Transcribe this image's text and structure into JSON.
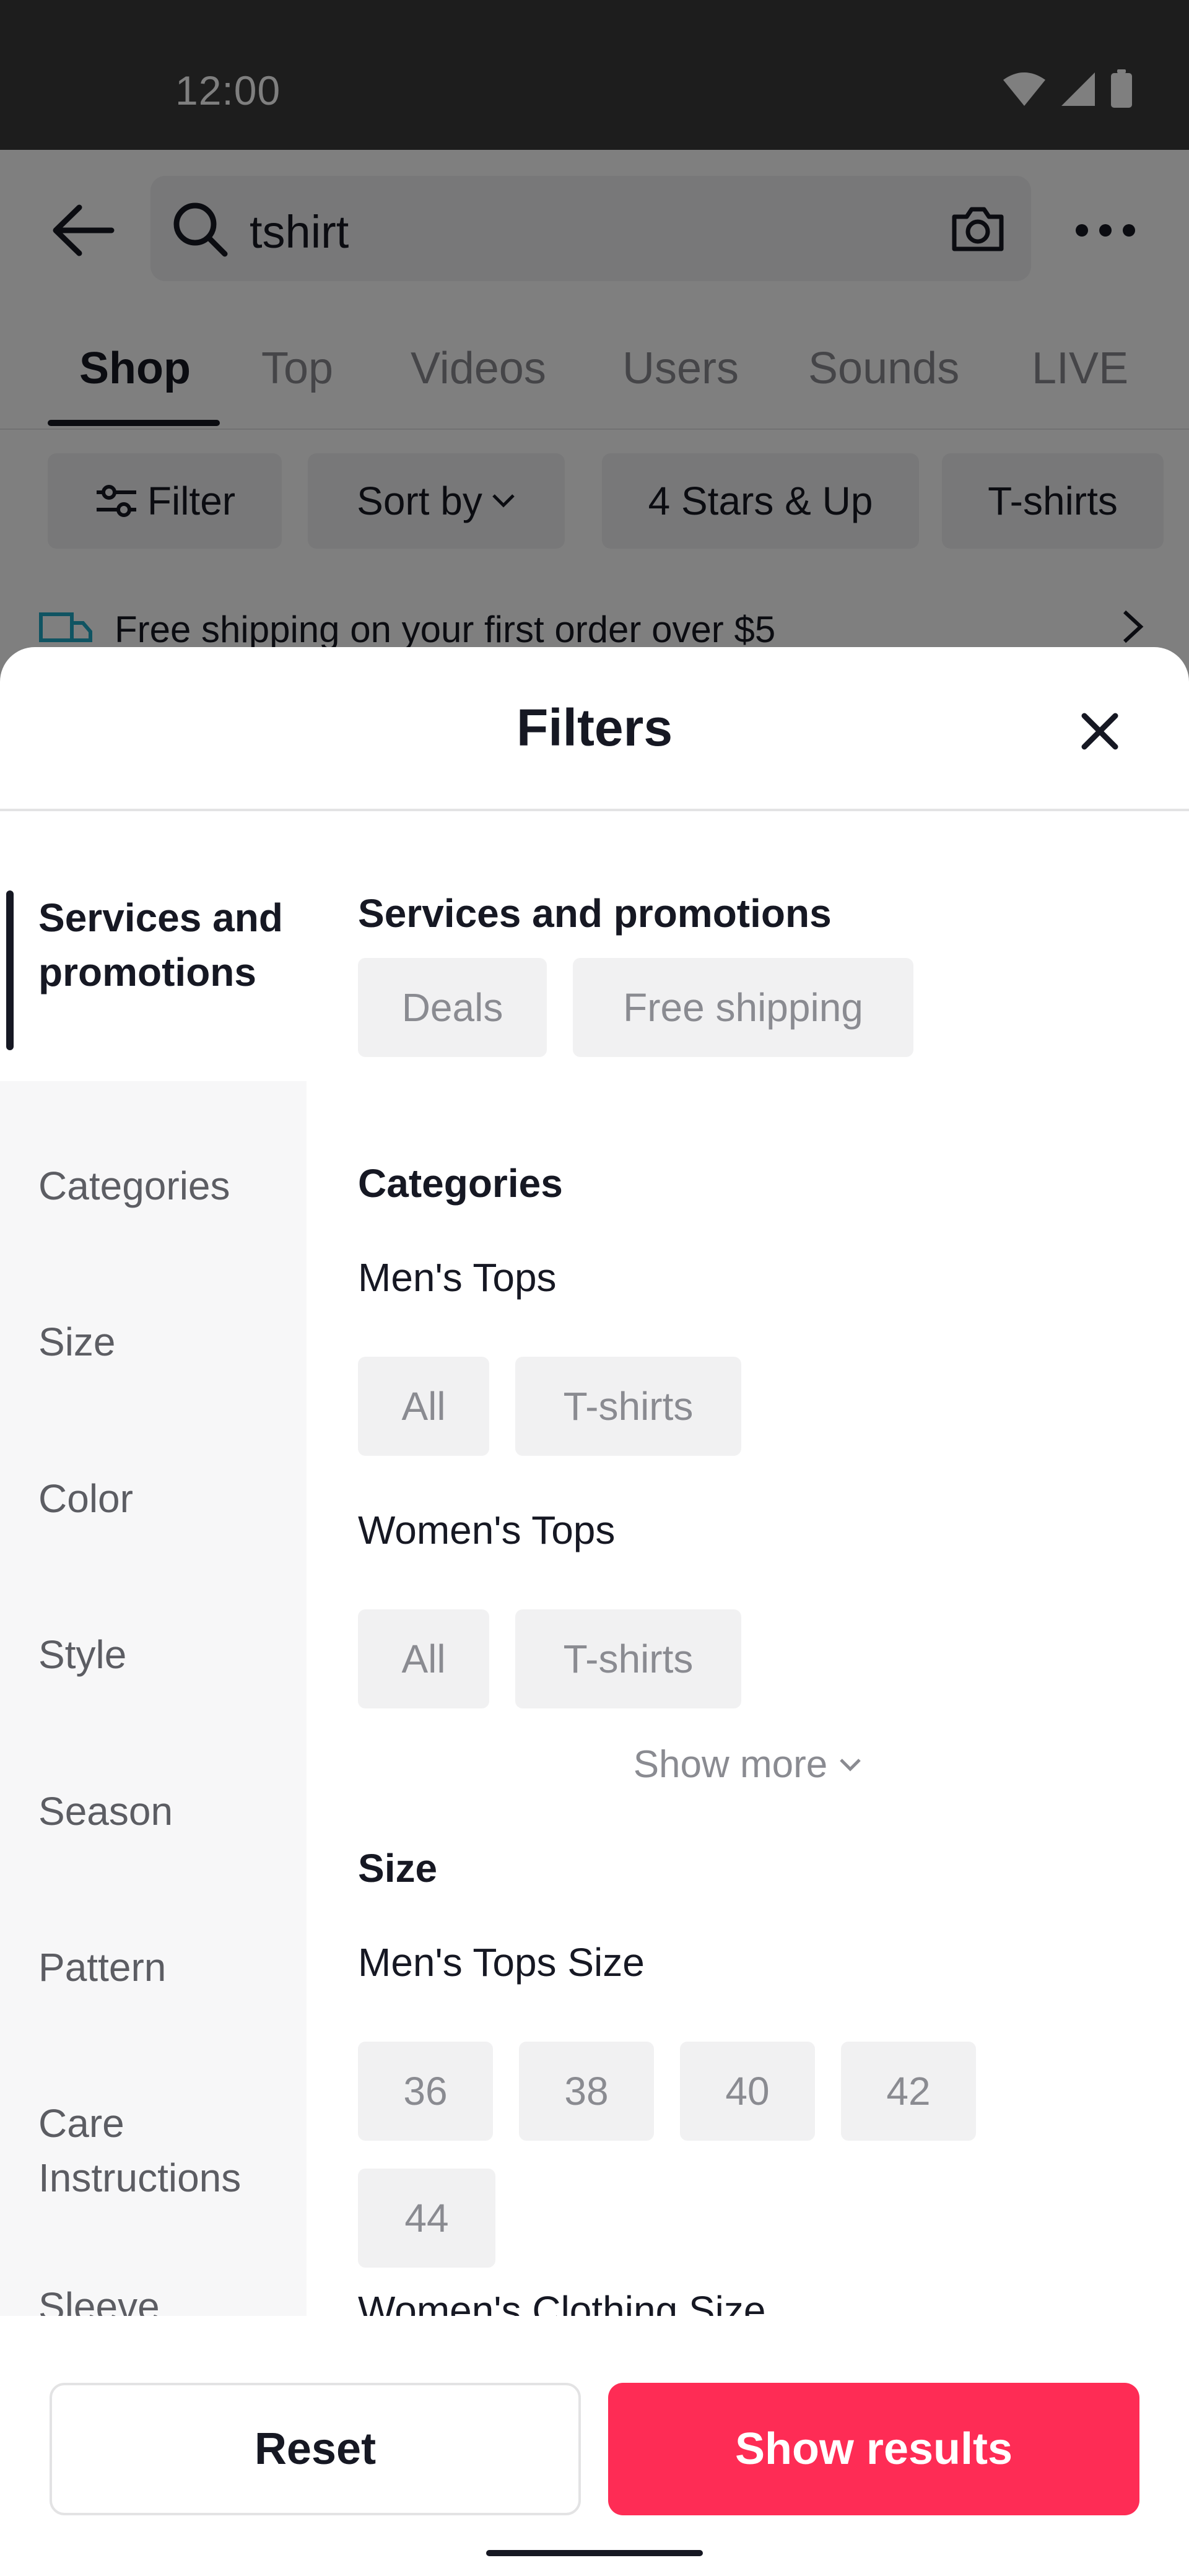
{
  "status_bar": {
    "time": "12:00"
  },
  "search": {
    "query": "tshirt"
  },
  "tabs": [
    {
      "label": "Shop"
    },
    {
      "label": "Top"
    },
    {
      "label": "Videos"
    },
    {
      "label": "Users"
    },
    {
      "label": "Sounds"
    },
    {
      "label": "LIVE"
    }
  ],
  "top_chips": [
    {
      "label": "Filter"
    },
    {
      "label": "Sort by"
    },
    {
      "label": "4 Stars & Up"
    },
    {
      "label": "T-shirts"
    }
  ],
  "promo": {
    "text": "Free shipping on your first order over $5"
  },
  "sheet": {
    "title": "Filters",
    "nav": [
      {
        "label": "Services and promotions"
      },
      {
        "label": "Categories"
      },
      {
        "label": "Size"
      },
      {
        "label": "Color"
      },
      {
        "label": "Style"
      },
      {
        "label": "Season"
      },
      {
        "label": "Pattern"
      },
      {
        "label": "Care Instructions"
      },
      {
        "label": "Sleeve"
      }
    ],
    "services": {
      "title": "Services and promotions",
      "chips": [
        "Deals",
        "Free shipping"
      ]
    },
    "categories": {
      "title": "Categories",
      "mens_title": "Men's Tops",
      "mens_chips": [
        "All",
        "T-shirts"
      ],
      "womens_title": "Women's Tops",
      "womens_chips": [
        "All",
        "T-shirts"
      ],
      "show_more": "Show more"
    },
    "size": {
      "title": "Size",
      "mens_title": "Men's Tops Size",
      "mens_chips": [
        "36",
        "38",
        "40",
        "42",
        "44"
      ],
      "womens_title": "Women's Clothing Size"
    },
    "footer": {
      "reset": "Reset",
      "show_results": "Show results"
    }
  },
  "colors": {
    "accent": "#fe2c55",
    "text_primary": "#161823",
    "text_secondary": "#8a8b91",
    "chip_bg": "#f1f1f2",
    "status_bar_bg": "#3a3a3a"
  }
}
